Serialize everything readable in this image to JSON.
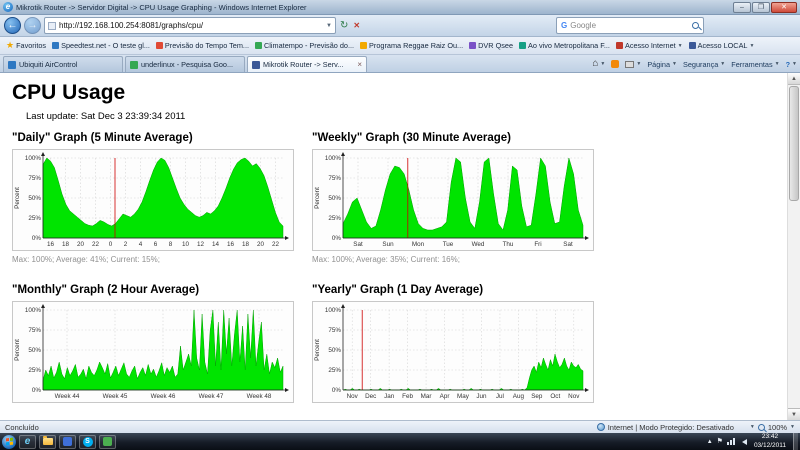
{
  "window": {
    "title": "Mikrotik Router -> Servidor Digital -> CPU Usage Graphing - Windows Internet Explorer"
  },
  "nav": {
    "url": "http://192.168.100.254:8081/graphs/cpu/",
    "search_placeholder": "Google"
  },
  "favorites": {
    "label": "Favoritos",
    "items": [
      "Speedtest.net - O teste gl...",
      "Previsão do Tempo  Tem...",
      "Climatempo - Previsão do...",
      "Programa Reggae Raiz Ou...",
      "DVR Qsee",
      "Ao vivo  Metropolitana F...",
      "Acesso Internet",
      "Acesso LOCAL"
    ]
  },
  "tabs": [
    {
      "label": "Ubiquiti AirControl"
    },
    {
      "label": "underlinux - Pesquisa Goo..."
    },
    {
      "label": "Mikrotik Router -> Serv..."
    }
  ],
  "command_bar": {
    "page": "Página",
    "safety": "Segurança",
    "tools": "Ferramentas"
  },
  "page": {
    "title": "CPU Usage",
    "last_update": "Last update: Sat Dec 3 23:39:34 2011"
  },
  "chart_data": [
    {
      "type": "area",
      "title": "\"Daily\" Graph (5 Minute Average)",
      "stats": "Max: 100%; Average: 41%; Current: 15%;",
      "ylabel": "Percent",
      "ylim": [
        0,
        100
      ],
      "yticks": [
        0,
        25,
        50,
        75,
        100
      ],
      "x_ticks": [
        "16",
        "18",
        "20",
        "22",
        "0",
        "2",
        "4",
        "6",
        "8",
        "10",
        "12",
        "14",
        "16",
        "18",
        "20",
        "22"
      ],
      "values": [
        92,
        100,
        96,
        88,
        72,
        55,
        42,
        34,
        30,
        26,
        22,
        18,
        16,
        15,
        18,
        22,
        20,
        17,
        15,
        18,
        24,
        30,
        28,
        26,
        30,
        36,
        45,
        58,
        72,
        85,
        95,
        100,
        97,
        88,
        75,
        62,
        50,
        42,
        36,
        32,
        28,
        26,
        28,
        32,
        30,
        34,
        40,
        50,
        62,
        75,
        86,
        94,
        98,
        100,
        96,
        90,
        93,
        87,
        78,
        64,
        48,
        32,
        20,
        15
      ],
      "marker_frac": 0.3,
      "fill": "#00e400",
      "stroke": "#00a000",
      "marker_color": "#cc0000"
    },
    {
      "type": "area",
      "title": "\"Weekly\" Graph (30 Minute Average)",
      "stats": "Max: 100%; Average: 35%; Current: 16%;",
      "ylabel": "Percent",
      "ylim": [
        0,
        100
      ],
      "yticks": [
        0,
        25,
        50,
        75,
        100
      ],
      "x_ticks": [
        "Sat",
        "Sun",
        "Mon",
        "Tue",
        "Wed",
        "Thu",
        "Fri",
        "Sat"
      ],
      "values": [
        18,
        30,
        45,
        50,
        35,
        20,
        12,
        15,
        35,
        60,
        80,
        90,
        88,
        80,
        60,
        35,
        18,
        12,
        10,
        10,
        12,
        14,
        20,
        70,
        100,
        95,
        50,
        20,
        12,
        45,
        95,
        100,
        55,
        18,
        10,
        35,
        90,
        85,
        40,
        14,
        16,
        55,
        100,
        90,
        45,
        18,
        20,
        65,
        100,
        80,
        35,
        16
      ],
      "marker_frac": 0.27,
      "fill": "#00e400",
      "stroke": "#00a000",
      "marker_color": "#cc0000"
    },
    {
      "type": "area",
      "title": "\"Monthly\" Graph (2 Hour Average)",
      "stats": "",
      "ylabel": "Percent",
      "ylim": [
        0,
        100
      ],
      "yticks": [
        0,
        25,
        50,
        75,
        100
      ],
      "x_ticks": [
        "Week 44",
        "Week 45",
        "Week 46",
        "Week 47",
        "Week 48"
      ],
      "values": [
        12,
        25,
        18,
        30,
        15,
        22,
        35,
        20,
        14,
        28,
        18,
        24,
        32,
        16,
        20,
        26,
        14,
        30,
        22,
        18,
        25,
        35,
        28,
        20,
        33,
        15,
        22,
        30,
        18,
        26,
        34,
        20,
        16,
        24,
        30,
        14,
        22,
        28,
        18,
        32,
        20,
        26,
        16,
        24,
        34,
        18,
        28,
        22,
        30,
        16,
        20,
        55,
        25,
        35,
        45,
        30,
        100,
        40,
        25,
        95,
        35,
        20,
        75,
        100,
        30,
        85,
        25,
        100,
        45,
        90,
        30,
        70,
        100,
        35,
        80,
        25,
        95,
        40,
        100,
        30,
        60,
        85,
        25,
        45,
        20,
        35,
        28,
        40,
        22,
        30
      ],
      "marker_frac": null,
      "fill": "#00e400",
      "stroke": "#00a000",
      "marker_color": "#cc0000"
    },
    {
      "type": "area",
      "title": "\"Yearly\" Graph (1 Day Average)",
      "stats": "",
      "ylabel": "Percent",
      "ylim": [
        0,
        100
      ],
      "yticks": [
        0,
        25,
        50,
        75,
        100
      ],
      "x_ticks": [
        "Nov",
        "Dec",
        "Jan",
        "Feb",
        "Mar",
        "Apr",
        "May",
        "Jun",
        "Jul",
        "Aug",
        "Sep",
        "Oct",
        "Nov"
      ],
      "values": [
        0,
        1,
        0,
        0,
        2,
        0,
        0,
        1,
        0,
        0,
        0,
        0,
        1,
        0,
        0,
        0,
        2,
        0,
        0,
        0,
        1,
        0,
        0,
        0,
        0,
        1,
        0,
        0,
        2,
        0,
        0,
        0,
        0,
        1,
        0,
        0,
        0,
        0,
        1,
        0,
        0,
        2,
        0,
        0,
        0,
        0,
        1,
        0,
        0,
        0,
        0,
        0,
        1,
        0,
        0,
        2,
        0,
        0,
        0,
        1,
        0,
        0,
        0,
        0,
        1,
        0,
        0,
        0,
        2,
        0,
        0,
        0,
        1,
        0,
        0,
        0,
        0,
        1,
        0,
        3,
        15,
        25,
        30,
        22,
        35,
        28,
        40,
        32,
        25,
        38,
        30,
        45,
        35,
        28,
        32,
        40,
        30,
        25,
        35,
        30,
        28,
        32,
        26,
        24
      ],
      "marker_frac": 0.08,
      "fill": "#00e400",
      "stroke": "#00a000",
      "marker_color": "#cc0000"
    }
  ],
  "status_bar": {
    "status": "Concluído",
    "zone": "Internet | Modo Protegido: Desativado",
    "zoom": "100%"
  },
  "taskbar": {
    "time": "23:42",
    "date": "03/12/2011"
  }
}
